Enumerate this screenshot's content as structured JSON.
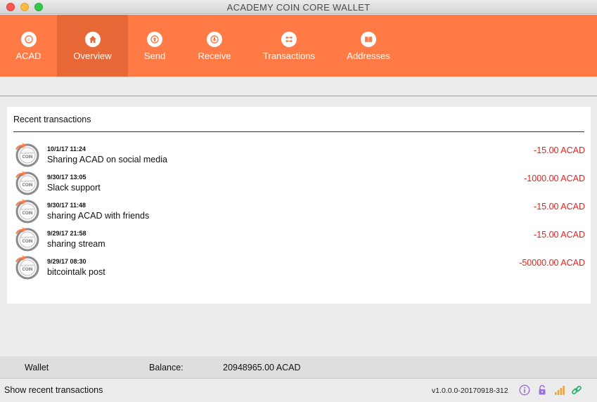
{
  "window": {
    "title": "ACADEMY COIN CORE WALLET"
  },
  "toolbar": {
    "tabs": [
      {
        "label": "ACAD",
        "icon": "academy-coin-logo-icon"
      },
      {
        "label": "Overview",
        "icon": "home-icon",
        "active": true
      },
      {
        "label": "Send",
        "icon": "send-arrow-up-icon"
      },
      {
        "label": "Receive",
        "icon": "receive-arrow-down-icon"
      },
      {
        "label": "Transactions",
        "icon": "transactions-icon"
      },
      {
        "label": "Addresses",
        "icon": "address-book-icon"
      }
    ]
  },
  "recent": {
    "title": "Recent transactions",
    "items": [
      {
        "date": "10/1/17 11:24",
        "label": "Sharing ACAD on social media",
        "amount": "-15.00 ACAD"
      },
      {
        "date": "9/30/17 13:05",
        "label": "Slack support",
        "amount": "-1000.00 ACAD"
      },
      {
        "date": "9/30/17 11:48",
        "label": "sharing ACAD with friends",
        "amount": "-15.00 ACAD"
      },
      {
        "date": "9/29/17 21:58",
        "label": "sharing stream",
        "amount": "-15.00 ACAD"
      },
      {
        "date": "9/29/17 08:30",
        "label": "bitcointalk post",
        "amount": "-50000.00 ACAD"
      }
    ]
  },
  "balance": {
    "wallet_label": "Wallet",
    "balance_label": "Balance:",
    "balance_value": "20948965.00 ACAD"
  },
  "status": {
    "message": "Show recent transactions",
    "version": "v1.0.0.0-20170918-312"
  },
  "colors": {
    "accent": "#ff7a45",
    "accent_active": "#e96837",
    "negative": "#e0231e",
    "status_icons": "#9a6fd8"
  }
}
